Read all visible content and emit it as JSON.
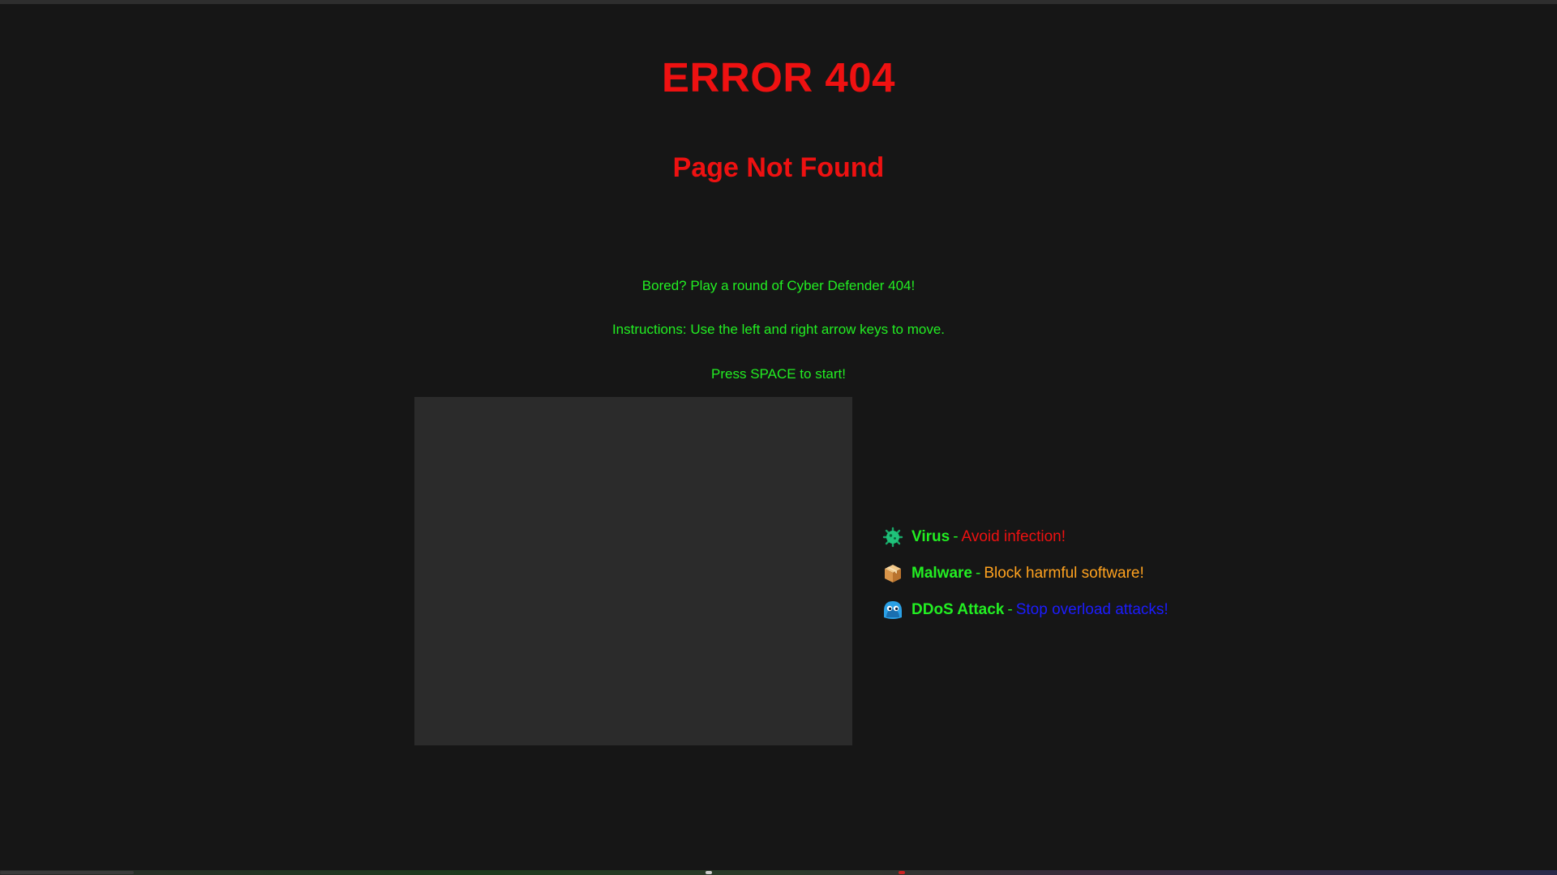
{
  "header": {
    "title": "ERROR 404",
    "subtitle": "Page Not Found"
  },
  "intro": {
    "line1": "Bored? Play a round of Cyber Defender 404!",
    "line2": "Instructions: Use the left and right arrow keys to move.",
    "line3": "Press SPACE to start!"
  },
  "legend": {
    "items": [
      {
        "icon": "virus-icon",
        "name": "Virus",
        "separator": "-",
        "desc": "Avoid infection!",
        "desc_color": "#ee1111"
      },
      {
        "icon": "package-icon",
        "name": "Malware",
        "separator": "-",
        "desc": "Block harmful software!",
        "desc_color": "#ffa21f"
      },
      {
        "icon": "ddos-icon",
        "name": "DDoS Attack",
        "separator": "-",
        "desc": "Stop overload attacks!",
        "desc_color": "#1c1cff"
      }
    ]
  },
  "colors": {
    "background": "#161616",
    "title": "#ee1111",
    "text": "#22ee22",
    "canvas": "#2b2b2b"
  }
}
